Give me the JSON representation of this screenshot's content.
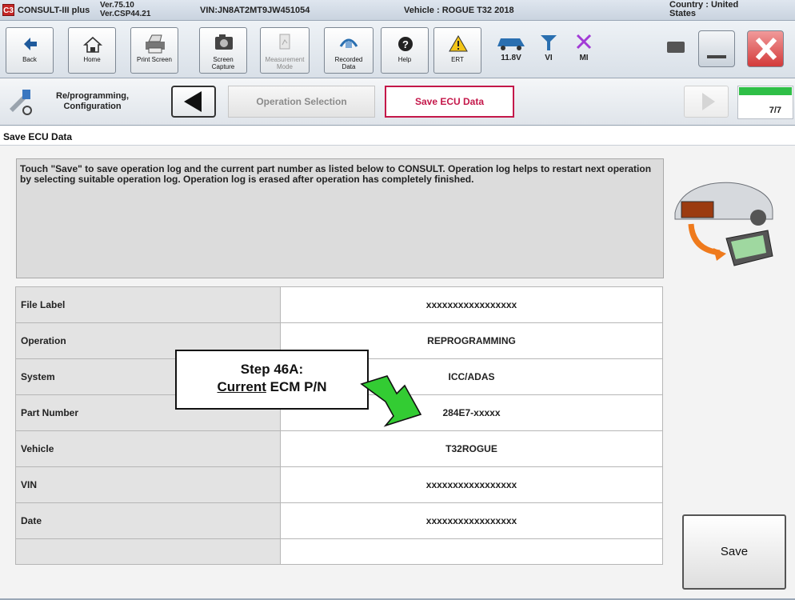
{
  "titlebar": {
    "logo": "C3",
    "app_name": "CONSULT-III plus",
    "ver1": "Ver.75.10",
    "ver2": "Ver.CSP44.21",
    "vin": "VIN:JN8AT2MT9JW451054",
    "vehicle": "Vehicle : ROGUE T32 2018",
    "country1": "Country : United",
    "country2": "States"
  },
  "toolbar": {
    "back": "Back",
    "home": "Home",
    "print": "Print Screen",
    "screen1": "Screen",
    "screen2": "Capture",
    "meas1": "Measurement",
    "meas2": "Mode",
    "rec1": "Recorded",
    "rec2": "Data",
    "help": "Help",
    "ert": "ERT",
    "battery": "11.8V",
    "vi": "VI",
    "mi": "MI"
  },
  "breadcrumb": {
    "first1": "Re/programming,",
    "first2": "Configuration",
    "op": "Operation Selection",
    "active": "Save ECU Data",
    "progress": "7/7",
    "progress_fraction": 1.0
  },
  "section_title": "Save ECU Data",
  "message": "Touch \"Save\" to save operation log and the current part number as listed below to CONSULT. Operation log helps to restart next operation by selecting suitable operation log. Operation log is erased after operation has completely finished.",
  "rows": [
    {
      "label": "File Label",
      "value": "xxxxxxxxxxxxxxxxx"
    },
    {
      "label": "Operation",
      "value": "REPROGRAMMING"
    },
    {
      "label": "System",
      "value": "ICC/ADAS"
    },
    {
      "label": "Part Number",
      "value": "284E7-xxxxx"
    },
    {
      "label": "Vehicle",
      "value": "T32ROGUE"
    },
    {
      "label": "VIN",
      "value": "xxxxxxxxxxxxxxxxx"
    },
    {
      "label": "Date",
      "value": "xxxxxxxxxxxxxxxxx"
    }
  ],
  "save_label": "Save",
  "callout": {
    "line1": "Step 46A:",
    "line2_underlined": "Current",
    "line2_rest": " ECM P/N"
  },
  "colors": {
    "accent_pink": "#c4184a",
    "progress_green": "#2fbf47",
    "arrow_green": "#33cc33"
  }
}
